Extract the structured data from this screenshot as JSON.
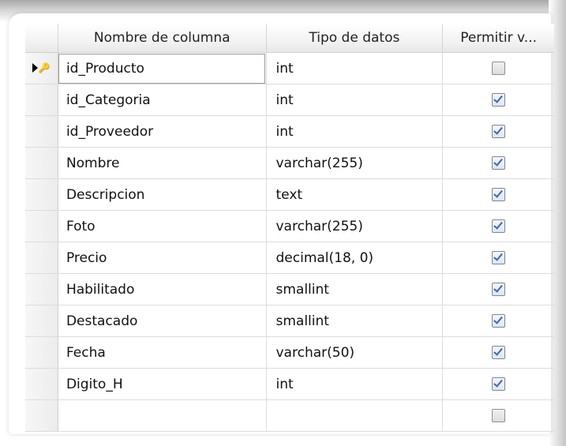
{
  "table": {
    "columns": {
      "name": "Nombre de columna",
      "type": "Tipo de datos",
      "nullable": "Permitir v..."
    },
    "rows": [
      {
        "name": "id_Producto",
        "type": "int",
        "allow_nulls": false,
        "primary_key": true
      },
      {
        "name": "id_Categoria",
        "type": "int",
        "allow_nulls": true
      },
      {
        "name": "id_Proveedor",
        "type": "int",
        "allow_nulls": true
      },
      {
        "name": "Nombre",
        "type": "varchar(255)",
        "allow_nulls": true
      },
      {
        "name": "Descripcion",
        "type": "text",
        "allow_nulls": true
      },
      {
        "name": "Foto",
        "type": "varchar(255)",
        "allow_nulls": true
      },
      {
        "name": "Precio",
        "type": "decimal(18, 0)",
        "allow_nulls": true
      },
      {
        "name": "Habilitado",
        "type": "smallint",
        "allow_nulls": true
      },
      {
        "name": "Destacado",
        "type": "smallint",
        "allow_nulls": true
      },
      {
        "name": "Fecha",
        "type": "varchar(50)",
        "allow_nulls": true
      },
      {
        "name": "Digito_H",
        "type": "int",
        "allow_nulls": true
      },
      {
        "name": "",
        "type": "",
        "allow_nulls": false
      }
    ]
  },
  "icons": {
    "current_row": "row-pointer-icon",
    "primary_key": "primary-key-icon"
  }
}
